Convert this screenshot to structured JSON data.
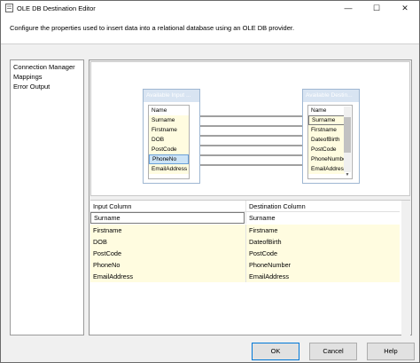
{
  "window": {
    "title": "OLE DB Destination Editor",
    "minimize": "—",
    "maximize": "☐",
    "close": "✕"
  },
  "description": "Configure the properties used to insert data into a relational database using an OLE DB provider.",
  "nav": {
    "items": [
      "Connection Manager",
      "Mappings",
      "Error Output"
    ]
  },
  "input_box": {
    "title": "Available Input ...",
    "columns": [
      "Name",
      "Surname",
      "Firstname",
      "DOB",
      "PostCode",
      "PhoneNo",
      "EmailAddress"
    ]
  },
  "dest_box": {
    "title": "Available Destin...",
    "columns": [
      "Name",
      "Surname",
      "Firstname",
      "DateofBirth",
      "PostCode",
      "PhoneNumber",
      "EmailAddress"
    ]
  },
  "grid": {
    "headers": [
      "Input Column",
      "Destination Column"
    ],
    "rows": [
      [
        "Surname",
        "Surname"
      ],
      [
        "Firstname",
        "Firstname"
      ],
      [
        "DOB",
        "DateofBirth"
      ],
      [
        "PostCode",
        "PostCode"
      ],
      [
        "PhoneNo",
        "PhoneNumber"
      ],
      [
        "EmailAddress",
        "EmailAddress"
      ]
    ]
  },
  "buttons": {
    "ok": "OK",
    "cancel": "Cancel",
    "help": "Help"
  },
  "colors": {
    "selection": "#cce4f7",
    "mapped_row": "#fffce0",
    "header_fill": "#d8e4f2"
  }
}
